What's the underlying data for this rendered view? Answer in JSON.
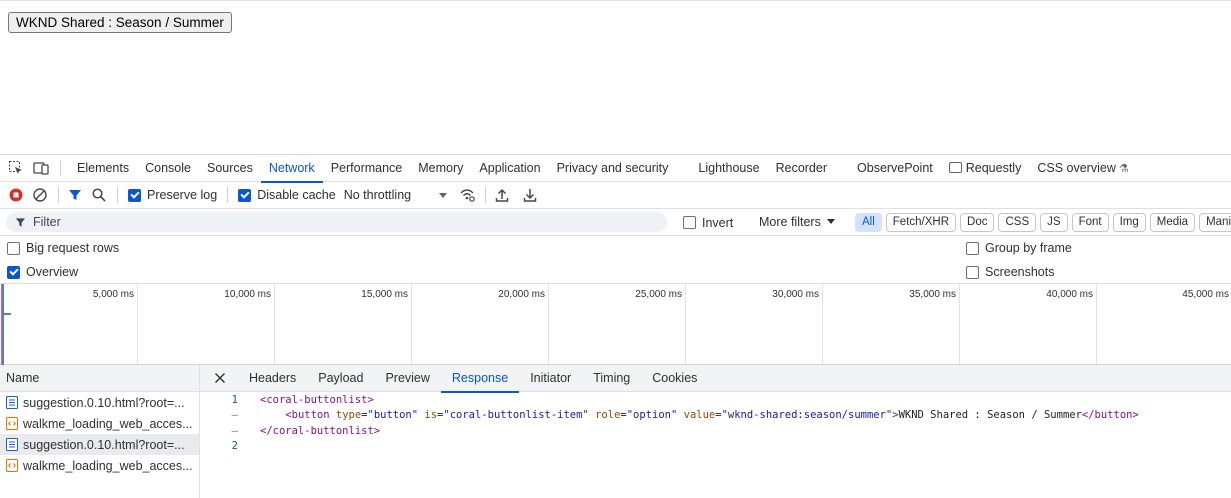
{
  "page": {
    "button_label": "WKND Shared : Season / Summer"
  },
  "devtools": {
    "tool_icons": [
      "inspect-element-icon",
      "device-toolbar-icon"
    ],
    "tabs": [
      {
        "label": "Elements"
      },
      {
        "label": "Console"
      },
      {
        "label": "Sources"
      },
      {
        "label": "Network",
        "active": true
      },
      {
        "label": "Performance"
      },
      {
        "label": "Memory"
      },
      {
        "label": "Application"
      },
      {
        "label": "Privacy and security"
      },
      {
        "label": "Lighthouse"
      },
      {
        "label": "Recorder"
      },
      {
        "label": "ObservePoint"
      },
      {
        "label": "Requestly"
      },
      {
        "label": "CSS overview"
      }
    ],
    "toolbar": {
      "preserve_log": {
        "label": "Preserve log",
        "checked": true
      },
      "disable_cache": {
        "label": "Disable cache",
        "checked": true
      },
      "throttling": "No throttling"
    },
    "filter": {
      "placeholder": "Filter",
      "invert_label": "Invert",
      "more_filters": "More filters",
      "types": [
        {
          "label": "All",
          "active": true
        },
        {
          "label": "Fetch/XHR"
        },
        {
          "label": "Doc"
        },
        {
          "label": "CSS"
        },
        {
          "label": "JS"
        },
        {
          "label": "Font"
        },
        {
          "label": "Img"
        },
        {
          "label": "Media"
        },
        {
          "label": "Manife"
        }
      ]
    },
    "options": {
      "big_request_rows": {
        "label": "Big request rows",
        "checked": false
      },
      "overview": {
        "label": "Overview",
        "checked": true
      },
      "group_by_frame": {
        "label": "Group by frame",
        "checked": false
      },
      "screenshots": {
        "label": "Screenshots",
        "checked": false
      }
    },
    "overview_ticks": [
      "5,000 ms",
      "10,000 ms",
      "15,000 ms",
      "20,000 ms",
      "25,000 ms",
      "30,000 ms",
      "35,000 ms",
      "40,000 ms",
      "45,000 ms"
    ],
    "requests": {
      "header": "Name",
      "items": [
        {
          "name": "suggestion.0.10.html?root=...",
          "type": "doc",
          "selected": false
        },
        {
          "name": "walkme_loading_web_acces...",
          "type": "script",
          "selected": false
        },
        {
          "name": "suggestion.0.10.html?root=...",
          "type": "doc",
          "selected": true
        },
        {
          "name": "walkme_loading_web_acces...",
          "type": "script",
          "selected": false
        }
      ]
    },
    "detail": {
      "tabs": [
        {
          "label": "Headers"
        },
        {
          "label": "Payload"
        },
        {
          "label": "Preview"
        },
        {
          "label": "Response",
          "active": true
        },
        {
          "label": "Initiator"
        },
        {
          "label": "Timing"
        },
        {
          "label": "Cookies"
        }
      ],
      "response": {
        "line1_num": "1",
        "line1": "<coral-buttonlist>",
        "line2_num": "–",
        "line2_tag_open": "<button",
        "line2_attr1": " type",
        "line2_val1": "\"button\"",
        "line2_attr2": " is",
        "line2_val2": "\"coral-buttonlist-item\"",
        "line2_attr3": " role",
        "line2_val3": "\"option\"",
        "line2_attr4": " value",
        "line2_val4": "\"wknd-shared:season/summer\"",
        "line2_text": "WKND Shared : Season / Summer",
        "line2_tag_close": "</button>",
        "line3_num": "–",
        "line3": "</coral-buttonlist>",
        "line4_num": "2",
        "line4": ""
      }
    }
  }
}
